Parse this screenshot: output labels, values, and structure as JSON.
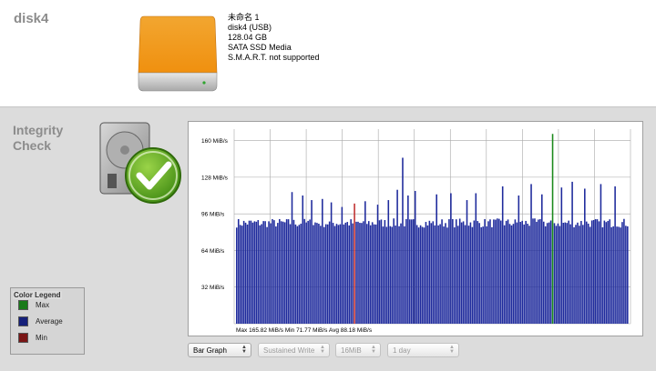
{
  "disk": {
    "title": "disk4",
    "info": [
      "未命名 1",
      "disk4 (USB)",
      "128.04 GB",
      "SATA SSD Media",
      "S.M.A.R.T. not supported"
    ]
  },
  "integrity": {
    "title": "Integrity Check"
  },
  "legend": {
    "title": "Color Legend",
    "items": [
      {
        "label": "Max",
        "color": "#1a7a1a"
      },
      {
        "label": "Average",
        "color": "#16207a"
      },
      {
        "label": "Min",
        "color": "#7a1616"
      }
    ]
  },
  "controls": {
    "graph_type": "Bar Graph",
    "test_mode": "Sustained Write",
    "block_size": "16MiB",
    "duration": "1 day"
  },
  "chart_data": {
    "type": "bar",
    "ylabel_ticks": [
      "32 MiB/s",
      "64 MiB/s",
      "96 MiB/s",
      "128 MiB/s",
      "160 MiB/s"
    ],
    "ylim": [
      0,
      170
    ],
    "grid": true,
    "summary": "Max 165.82 MiB/s Min 71.77 MiB/s Avg 88.18 MiB/s",
    "max": 165.82,
    "min": 71.77,
    "avg": 88.18,
    "bar_color": "#1e2a9c",
    "max_color": "#1a8a1a",
    "min_color": "#c03030",
    "spikes": [
      {
        "at": 0.14,
        "value": 115
      },
      {
        "at": 0.17,
        "value": 112
      },
      {
        "at": 0.19,
        "value": 108
      },
      {
        "at": 0.22,
        "value": 109
      },
      {
        "at": 0.24,
        "value": 106
      },
      {
        "at": 0.27,
        "value": 102
      },
      {
        "at": 0.3,
        "value": 105
      },
      {
        "at": 0.33,
        "value": 107
      },
      {
        "at": 0.36,
        "value": 104
      },
      {
        "at": 0.39,
        "value": 108
      },
      {
        "at": 0.41,
        "value": 117
      },
      {
        "at": 0.425,
        "value": 145
      },
      {
        "at": 0.44,
        "value": 112
      },
      {
        "at": 0.455,
        "value": 116
      },
      {
        "at": 0.51,
        "value": 113
      },
      {
        "at": 0.55,
        "value": 114
      },
      {
        "at": 0.59,
        "value": 108
      },
      {
        "at": 0.61,
        "value": 114
      },
      {
        "at": 0.68,
        "value": 120
      },
      {
        "at": 0.72,
        "value": 112
      },
      {
        "at": 0.755,
        "value": 122
      },
      {
        "at": 0.78,
        "value": 113
      },
      {
        "at": 0.83,
        "value": 119
      },
      {
        "at": 0.86,
        "value": 124
      },
      {
        "at": 0.89,
        "value": 118
      },
      {
        "at": 0.93,
        "value": 122
      },
      {
        "at": 0.97,
        "value": 120
      }
    ]
  }
}
